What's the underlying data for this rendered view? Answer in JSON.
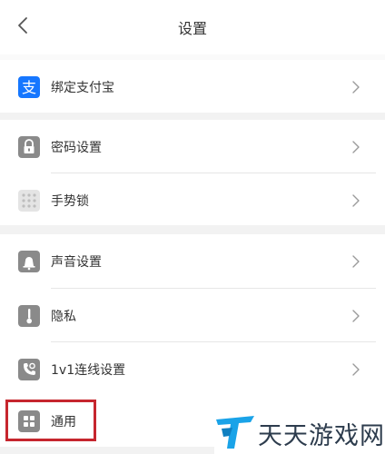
{
  "header": {
    "title": "设置",
    "back_icon": "chevron-left-icon"
  },
  "groups": [
    {
      "items": [
        {
          "label": "绑定支付宝",
          "icon": "alipay-icon",
          "icon_color": "#1677ff"
        }
      ]
    },
    {
      "items": [
        {
          "label": "密码设置",
          "icon": "lock-icon"
        },
        {
          "label": "手势锁",
          "icon": "gesture-grid-icon"
        }
      ]
    },
    {
      "items": [
        {
          "label": "声音设置",
          "icon": "bell-icon"
        },
        {
          "label": "隐私",
          "icon": "thermometer-icon"
        },
        {
          "label": "1v1连线设置",
          "icon": "call-icon"
        },
        {
          "label": "通用",
          "icon": "grid-icon"
        }
      ]
    }
  ],
  "highlight_color": "#c6262e",
  "watermark": {
    "text": "天天游戏网",
    "logo_color": "#1aa3e8"
  }
}
